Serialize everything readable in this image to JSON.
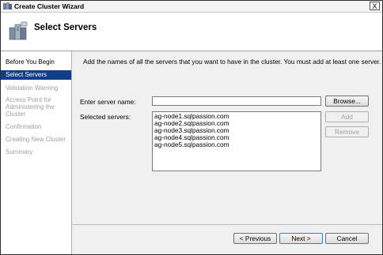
{
  "window": {
    "title": "Create Cluster Wizard",
    "close_label": "X"
  },
  "header": {
    "title": "Select Servers"
  },
  "sidebar": {
    "items": [
      {
        "label": "Before You Begin"
      },
      {
        "label": "Select Servers"
      },
      {
        "label": "Validation Warning"
      },
      {
        "label": "Access Point for Administering the Cluster"
      },
      {
        "label": "Confirmation"
      },
      {
        "label": "Creating New Cluster"
      },
      {
        "label": "Summary"
      }
    ]
  },
  "main": {
    "description": "Add the names of all the servers that you want to have in the cluster. You must add at least one server.",
    "server_name_label": "Enter server name:",
    "server_name_value": "",
    "selected_label": "Selected servers:",
    "selected_servers": [
      "ag-node1.sqlpassion.com",
      "ag-node2.sqlpassion.com",
      "ag-node3.sqlpassion.com",
      "ag-node4.sqlpassion.com",
      "ag-node5.sqlpassion.com"
    ],
    "browse_label": "Browse...",
    "add_label": "Add",
    "remove_label": "Remove"
  },
  "footer": {
    "previous_label": "< Previous",
    "next_label": "Next >",
    "cancel_label": "Cancel"
  },
  "colors": {
    "selection": "#123d88",
    "disabled_text": "#a0a0a0"
  }
}
